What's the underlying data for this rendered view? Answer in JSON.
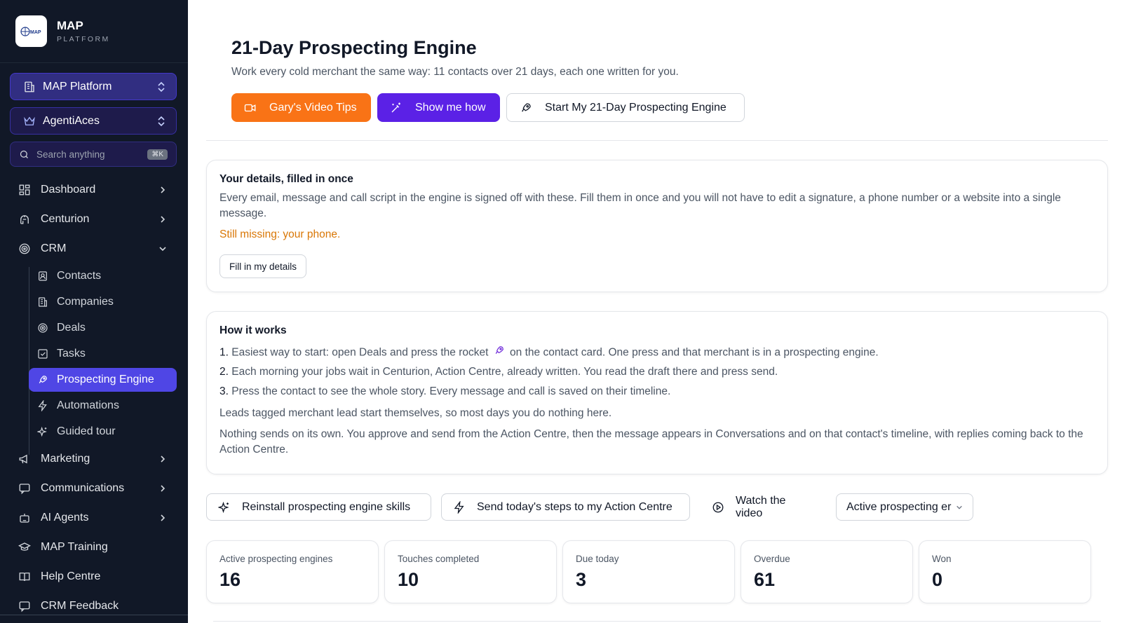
{
  "sidebar": {
    "brand_title": "MAP",
    "brand_subtitle": "PLATFORM",
    "logo_text": "MAP",
    "workspace": "MAP Platform",
    "account": "AgentiAces",
    "search_placeholder": "Search anything",
    "search_shortcut": "⌘K",
    "nav": {
      "dashboard": "Dashboard",
      "centurion": "Centurion",
      "crm": "CRM",
      "contacts": "Contacts",
      "companies": "Companies",
      "deals": "Deals",
      "tasks": "Tasks",
      "prospecting_engine": "Prospecting Engine",
      "automations": "Automations",
      "guided_tour": "Guided tour",
      "marketing": "Marketing",
      "communications": "Communications",
      "ai_agents": "AI Agents",
      "map_training": "MAP Training",
      "help_centre": "Help Centre",
      "crm_feedback": "CRM Feedback"
    }
  },
  "header": {
    "title": "21-Day Prospecting Engine",
    "subtitle": "Work every cold merchant the same way: 11 contacts over 21 days, each one written for you.",
    "video_tips": "Gary's Video Tips",
    "show_me_how": "Show me how",
    "start_engine": "Start My 21-Day Prospecting Engine"
  },
  "details_card": {
    "title": "Your details, filled in once",
    "text": "Every email, message and call script in the engine is signed off with these. Fill them in once and you will not have to edit a signature, a phone number or a website into a single message.",
    "missing": "Still missing: your phone.",
    "button": "Fill in my details"
  },
  "how_card": {
    "title": "How it works",
    "step1_num": "1.",
    "step1_a": "Easiest way to start: open Deals and press the rocket",
    "step1_b": "on the contact card. One press and that merchant is in a prospecting engine.",
    "step2_num": "2.",
    "step2": "Each morning your jobs wait in Centurion, Action Centre, already written. You read the draft there and press send.",
    "step3_num": "3.",
    "step3": "Press the contact to see the whole story. Every message and call is saved on their timeline.",
    "note1": "Leads tagged merchant lead start themselves, so most days you do nothing here.",
    "note2": "Nothing sends on its own. You approve and send from the Action Centre, then the message appears in Conversations and on that contact's timeline, with replies coming back to the Action Centre."
  },
  "actions": {
    "reinstall": "Reinstall prospecting engine skills",
    "send_steps": "Send today's steps to my Action Centre",
    "watch_video": "Watch the video",
    "filter_selected": "Active prospecting er"
  },
  "stats": [
    {
      "label": "Active prospecting engines",
      "value": "16"
    },
    {
      "label": "Touches completed",
      "value": "10"
    },
    {
      "label": "Due today",
      "value": "3"
    },
    {
      "label": "Overdue",
      "value": "61"
    },
    {
      "label": "Won",
      "value": "0"
    }
  ],
  "colors": {
    "sidebar_bg": "#111827",
    "accent": "#4f46e5",
    "orange": "#f97316",
    "purple": "#5b21e6",
    "warning": "#d97706"
  }
}
